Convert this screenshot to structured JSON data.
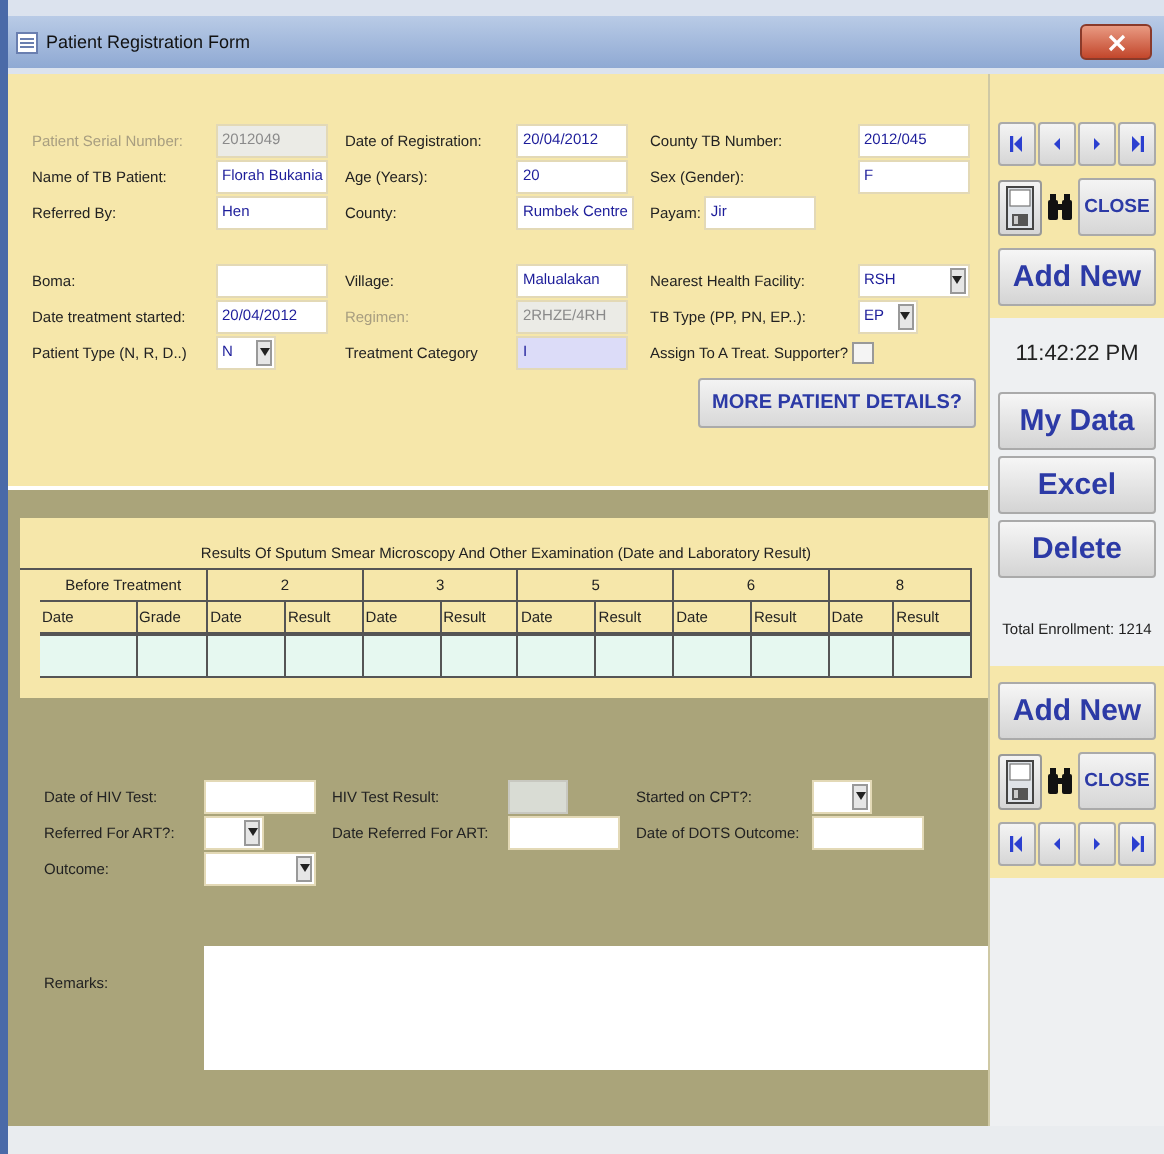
{
  "window": {
    "title": "Patient Registration Form"
  },
  "top_columns": [
    {
      "groups": [
        [
          {
            "label": "Patient Serial Number:",
            "value": "2012049",
            "kind": "text",
            "disabled": true
          },
          {
            "label": "Name of TB Patient:",
            "value": "Florah Bukania",
            "kind": "text",
            "disabled": false
          },
          {
            "label": "Referred By:",
            "value": "Hen",
            "kind": "text",
            "disabled": false
          }
        ],
        [
          {
            "label": "Boma:",
            "kind": "text",
            "disabled": false
          },
          {
            "label": "Date treatment started:",
            "value": "20/04/2012",
            "kind": "text",
            "disabled": false
          },
          {
            "label": "Patient Type (N, R, D..)",
            "value": "N",
            "kind": "dropdown",
            "disabled": false
          }
        ]
      ]
    },
    {
      "groups": [
        [
          {
            "label": "Date of Registration:",
            "value": "20/04/2012",
            "kind": "text",
            "disabled": false
          },
          {
            "label": "Age (Years):",
            "value": "20",
            "kind": "text",
            "disabled": false
          },
          {
            "label": "County:",
            "value": "Rumbek Centre",
            "kind": "text",
            "disabled": false
          }
        ],
        [
          {
            "label": "Village:",
            "value": "Malualakan",
            "kind": "text",
            "disabled": false
          },
          {
            "label": "Regimen:",
            "value": "2RHZE/4RH",
            "kind": "text",
            "disabled": true
          },
          {
            "label": "Treatment Category",
            "value": "I",
            "kind": "readonly",
            "disabled": false
          }
        ]
      ]
    },
    {
      "groups": [
        [
          {
            "label": "County TB Number:",
            "value": "2012/045",
            "kind": "text",
            "disabled": false
          },
          {
            "label": "Sex (Gender):",
            "value": "F",
            "kind": "text",
            "disabled": false
          },
          {
            "label": "Payam:",
            "value": "Jir",
            "kind": "text",
            "disabled": false
          }
        ],
        [
          {
            "label": "Nearest Health Facility:",
            "value": "RSH",
            "kind": "dropdown",
            "disabled": false
          },
          {
            "label": "TB Type (PP, PN, EP..):",
            "value": "EP",
            "kind": "dropdown",
            "disabled": false
          },
          {
            "label": "Assign To A Treat. Supporter?",
            "kind": "checkbox",
            "checked": false,
            "disabled": false
          }
        ]
      ]
    }
  ],
  "more_details_button": "MORE PATIENT DETAILS?",
  "results_table": {
    "title": "Results Of Sputum Smear Microscopy And Other Examination (Date and Laboratory Result)",
    "groups": [
      "Before Treatment",
      "2",
      "3",
      "5",
      "6",
      "8"
    ],
    "columns": [
      "Date",
      "Grade",
      "Date",
      "Result",
      "Date",
      "Result",
      "Date",
      "Result",
      "Date",
      "Result",
      "Date",
      "Result"
    ]
  },
  "bottom_columns": [
    {
      "fields": [
        {
          "label": "Date of HIV Test:",
          "kind": "text",
          "disabled": false
        },
        {
          "label": "Referred For ART?:",
          "kind": "dropdown",
          "disabled": false
        },
        {
          "label": "Outcome:",
          "kind": "dropdown",
          "disabled": false
        }
      ]
    },
    {
      "fields": [
        {
          "label": "HIV Test Result:",
          "kind": "text",
          "disabled": true
        },
        {
          "label": "Date Referred For ART:",
          "kind": "text",
          "disabled": false
        }
      ]
    },
    {
      "fields": [
        {
          "label": "Started on CPT?:",
          "kind": "dropdown",
          "disabled": false
        },
        {
          "label": "Date of DOTS Outcome:",
          "kind": "text",
          "disabled": false
        }
      ]
    }
  ],
  "remarks": {
    "label": "Remarks:"
  },
  "sidebar": {
    "close_top": "CLOSE",
    "add_new_top": "Add New",
    "clock": "11:42:22 PM",
    "actions": [
      "My Data",
      "Excel",
      "Delete"
    ],
    "total": "Total Enrollment: 1214",
    "add_new_bottom": "Add New",
    "close_bottom": "CLOSE"
  }
}
